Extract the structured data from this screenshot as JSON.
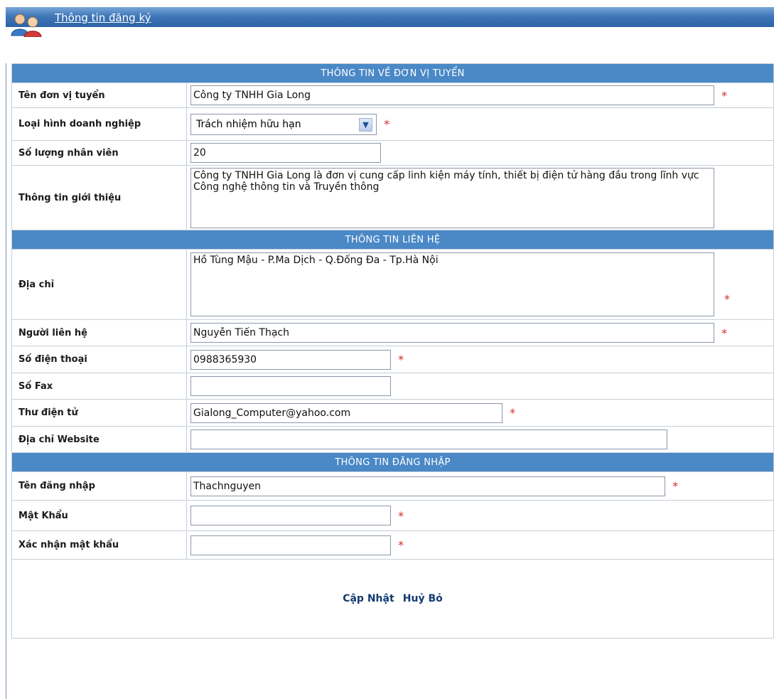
{
  "header": {
    "title": "Thông tin đăng ký",
    "icon": "users-icon"
  },
  "sections": {
    "company": "THÔNG TIN VỀ ĐƠN VỊ TUYỂN",
    "contact": "THÔNG TIN LIÊN HỆ",
    "login": "THÔNG TIN ĐĂNG NHẬP"
  },
  "fields": {
    "company_name": {
      "label": "Tên đơn vị tuyển",
      "value": "Công ty TNHH Gia Long"
    },
    "business_type": {
      "label": "Loại hình doanh nghiệp",
      "value": "Trách nhiệm hữu hạn"
    },
    "employee_count": {
      "label": "Số lượng nhân viên",
      "value": "20"
    },
    "introduction": {
      "label": "Thông tin giới thiệu",
      "value": "Công ty TNHH Gia Long là đơn vị cung cấp linh kiện máy tính, thiết bị điện tử hàng đầu trong lĩnh vực Công nghệ thông tin và Truyền thông"
    },
    "address": {
      "label": "Địa chỉ",
      "value": "Hồ Tùng Mậu - P.Ma Dịch - Q.Đống Đa - Tp.Hà Nội"
    },
    "contact_person": {
      "label": "Người liên hệ",
      "value": "Nguyễn Tiến Thạch"
    },
    "phone": {
      "label": "Số điện thoại",
      "value": "0988365930"
    },
    "fax": {
      "label": "Số Fax",
      "value": ""
    },
    "email": {
      "label": "Thư điện tử",
      "value": "Gialong_Computer@yahoo.com"
    },
    "website": {
      "label": "Địa chỉ Website",
      "value": ""
    },
    "username": {
      "label": "Tên đăng nhập",
      "value": "Thachnguyen"
    },
    "password": {
      "label": "Mật Khẩu",
      "value": ""
    },
    "confirm_password": {
      "label": "Xác nhận mật khẩu",
      "value": ""
    }
  },
  "required_mark": "*",
  "actions": {
    "update": "Cập Nhật",
    "cancel": "Huỷ Bỏ"
  },
  "colors": {
    "section_bg": "#4a88c6",
    "title_band": "#3f77b8",
    "required": "#d52a2a"
  }
}
